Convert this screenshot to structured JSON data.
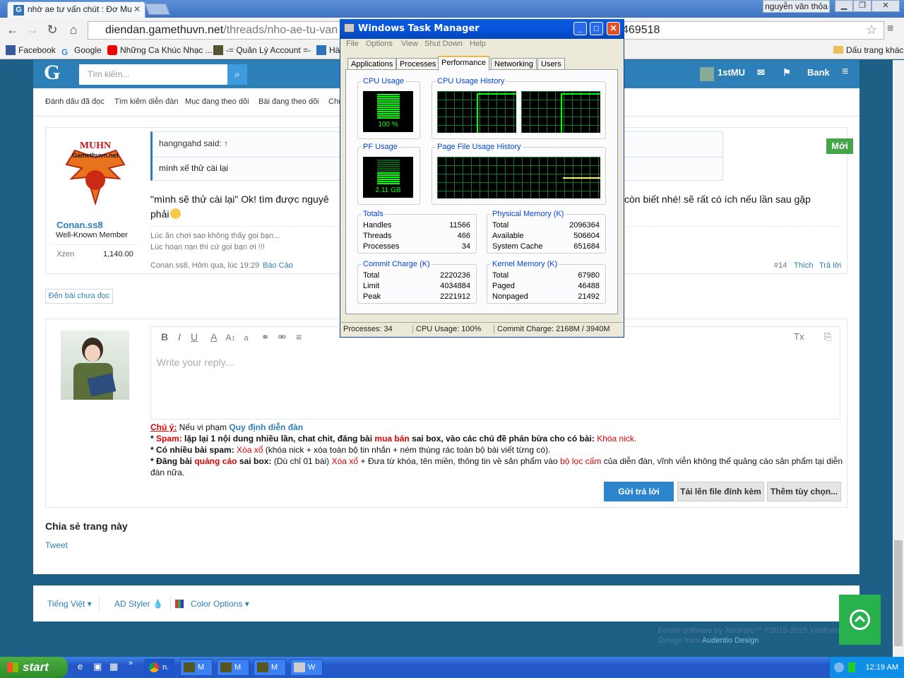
{
  "browser": {
    "tab_title": "nhờ ae tư vấn chút : Đơ Mu",
    "user_name": "nguyễn văn thỏa",
    "url_domain": "diendan.gamethuvn.net",
    "url_path": "/threads/nho-ae-tu-van",
    "url_suffix": "469518"
  },
  "bookmarks": [
    "Facebook",
    "Google",
    "Những Ca Khúc Nhạc ...",
    "-= Quản Lý Account =-",
    "Hà",
    "Dấu trang khác"
  ],
  "forum": {
    "search_placeholder": "Tìm kiếm...",
    "user": "1stMU",
    "bank": "Bank",
    "subnav": [
      "Đánh dấu đã đọc",
      "Tìm kiếm diễn đàn",
      "Mục đang theo dõi",
      "Bài đang theo dõi",
      "Chủ"
    ],
    "new_badge": "Mới",
    "post": {
      "author": "Conan.ss8",
      "rank": "Well-Known Member",
      "xzen_label": "Xzen",
      "xzen_value": "1,140.00",
      "logo_text_1": "MUHN",
      "logo_text_2": "Gamethuvn.net",
      "quote_author": "hangngahd said: ↑",
      "quote_text": "mình xế thử cài lại",
      "body": "\"mình sẽ thử cài lại\" Ok! tìm được nguyê",
      "body_right": "còn biết nhé! sẽ rất có ích nếu lần sau gặp",
      "body_end": "phải",
      "sig1": "Lúc ăn chơi sao không thấy gọi bạn...",
      "sig2": "Lúc hoạn nạn thì cứ gọi bạn ơi !!!",
      "meta": "Conan.ss8, Hôm qua, lúc 19:29",
      "report": "Báo Cáo",
      "num": "#14",
      "like": "Thích",
      "reply": "Trả lời"
    },
    "unread_button": "Đến bài chưa đọc",
    "editor_placeholder": "Write your reply...",
    "rules": {
      "title": "Chú ý:",
      "intro": " Nếu vi phạm ",
      "rule_link": "Quy định diễn đàn",
      "spam_label": "Spam:",
      "spam_text": " lặp lại 1 nội dung nhiều lần, chat chit, đăng bài ",
      "spam_buy": "mua bán",
      "spam_text2": " sai box, vào các chủ đề phán bừa cho có bài: ",
      "spam_penalty": "Khóa nick.",
      "multi_label": "* Có nhiều bài spam:",
      "multi_penalty": "Xóa xổ",
      "multi_text": " (khóa nick + xóa toàn bộ tin nhắn + ném thùng rác toàn bộ bài viết từng có).",
      "ad_label": "* Đăng bài ",
      "ad_word": "quảng cáo",
      "ad_label2": " sai box:",
      "ad_text": " (Dù chỉ 01 bài) ",
      "ad_penalty": "Xóa xổ",
      "ad_text2": " + Đưa từ khóa, tên miền, thông tin về sản phẩm vào ",
      "ad_filter": "bộ lọc cấm",
      "ad_text3": " của diễn đàn, vĩnh viễn không thể quảng cáo sản phẩm tại diễn đàn nữa."
    },
    "btn_post": "Gửi trả lời",
    "btn_upload": "Tải lên file đính kèm",
    "btn_more": "Thêm tùy chọn...",
    "share_title": "Chia sẻ trang này",
    "tweet": "Tweet",
    "footer": [
      "Tiếng Việt ▾",
      "AD Styler 💧",
      "Color Options ▾"
    ],
    "credit1": "Forum software by XenForo™ ©2010-2015 XenForo",
    "credit2": "Design from ",
    "credit_link": "Audentio Design"
  },
  "taskmgr": {
    "title": "Windows Task Manager",
    "menu": [
      "File",
      "Options",
      "View",
      "Shut Down",
      "Help"
    ],
    "tabs": [
      "Applications",
      "Processes",
      "Performance",
      "Networking",
      "Users"
    ],
    "cpu_usage": "CPU Usage",
    "cpu_value": "100 %",
    "cpu_history": "CPU Usage History",
    "pf_usage": "PF Usage",
    "pf_value": "2.11 GB",
    "pf_history": "Page File Usage History",
    "totals": {
      "title": "Totals",
      "rows": [
        [
          "Handles",
          "11566"
        ],
        [
          "Threads",
          "466"
        ],
        [
          "Processes",
          "34"
        ]
      ]
    },
    "physical": {
      "title": "Physical Memory (K)",
      "rows": [
        [
          "Total",
          "2096364"
        ],
        [
          "Available",
          "506604"
        ],
        [
          "System Cache",
          "651684"
        ]
      ]
    },
    "commit": {
      "title": "Commit Charge (K)",
      "rows": [
        [
          "Total",
          "2220236"
        ],
        [
          "Limit",
          "4034884"
        ],
        [
          "Peak",
          "2221912"
        ]
      ]
    },
    "kernel": {
      "title": "Kernel Memory (K)",
      "rows": [
        [
          "Total",
          "67980"
        ],
        [
          "Paged",
          "46488"
        ],
        [
          "Nonpaged",
          "21492"
        ]
      ]
    },
    "status": {
      "processes": "Processes: 34",
      "cpu": "CPU Usage: 100%",
      "commit": "Commit Charge: 2168M / 3940M"
    },
    "cpu_level": 1.0,
    "pf_level": 0.52
  },
  "taskbar": {
    "start": "start",
    "items": [
      "n.",
      "M",
      "M",
      "M",
      "W"
    ],
    "time": "12:19 AM"
  }
}
